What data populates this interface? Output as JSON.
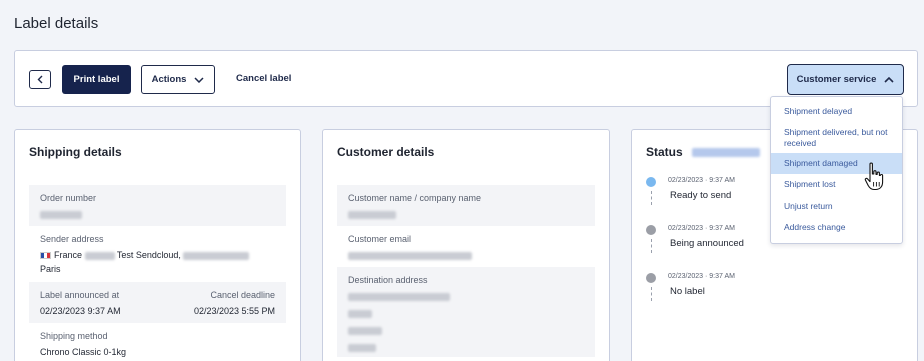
{
  "page": {
    "title": "Label details"
  },
  "toolbar": {
    "print_label": "Print label",
    "actions_label": "Actions",
    "cancel_label": "Cancel label",
    "customer_service_label": "Customer service"
  },
  "shipping": {
    "title": "Shipping details",
    "order_number_label": "Order number",
    "sender_address_label": "Sender address",
    "sender_country": "France",
    "sender_company": "Test Sendcloud,",
    "sender_city": "Paris",
    "label_announced_label": "Label announced at",
    "label_announced_value": "02/23/2023 9:37 AM",
    "cancel_deadline_label": "Cancel deadline",
    "cancel_deadline_value": "02/23/2023 5:55 PM",
    "shipping_method_label": "Shipping method",
    "shipping_method_value": "Chrono Classic 0-1kg"
  },
  "customer": {
    "title": "Customer details",
    "name_label": "Customer name / company name",
    "email_label": "Customer email",
    "destination_label": "Destination address"
  },
  "status": {
    "title": "Status",
    "events": [
      {
        "time": "02/23/2023 · 9:37 AM",
        "label": "Ready to send",
        "color": "#7ab8ef"
      },
      {
        "time": "02/23/2023 · 9:37 AM",
        "label": "Being announced",
        "color": "#9b9ea6"
      },
      {
        "time": "02/23/2023 · 9:37 AM",
        "label": "No label",
        "color": "#9b9ea6"
      }
    ]
  },
  "customer_service_menu": {
    "items": [
      "Shipment delayed",
      "Shipment delivered, but not received",
      "Shipment damaged",
      "Shipment lost",
      "Unjust return",
      "Address change"
    ],
    "highlighted": "Shipment damaged"
  },
  "colors": {
    "primary": "#16234d",
    "accent_light": "#c9def7",
    "link": "#3a5a9c"
  }
}
